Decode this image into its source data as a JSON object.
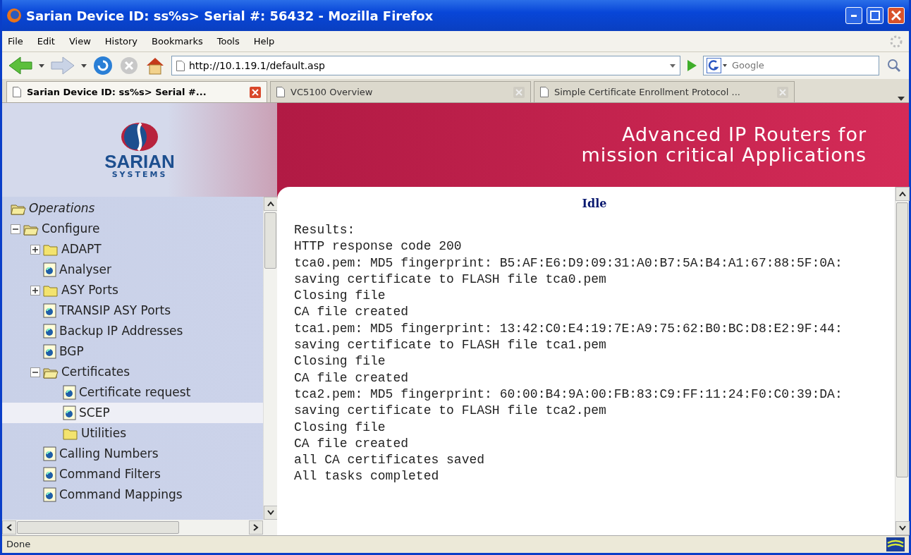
{
  "window": {
    "title": "Sarian Device ID: ss%s> Serial #: 56432 - Mozilla Firefox"
  },
  "menu": [
    "File",
    "Edit",
    "View",
    "History",
    "Bookmarks",
    "Tools",
    "Help"
  ],
  "address": {
    "value": "http://10.1.19.1/default.asp"
  },
  "search": {
    "placeholder": "Google"
  },
  "tabs": [
    {
      "label": "Sarian Device ID: ss%s> Serial #...",
      "selected": true
    },
    {
      "label": "VC5100 Overview",
      "selected": false
    },
    {
      "label": "Simple Certificate Enrollment Protocol ...",
      "selected": false
    }
  ],
  "logo": {
    "name": "SARIAN",
    "subtitle": "SYSTEMS"
  },
  "banner": {
    "lines": [
      "Advanced IP Routers for",
      "mission critical Applications"
    ]
  },
  "tree": {
    "root": "Operations",
    "items": [
      {
        "label": "Configure",
        "kind": "folder",
        "expanded": true,
        "selected": false,
        "children": [
          {
            "label": "ADAPT",
            "kind": "folder",
            "expanded": false,
            "selected": false
          },
          {
            "label": "Analyser",
            "kind": "page",
            "selected": false
          },
          {
            "label": "ASY Ports",
            "kind": "folder",
            "expanded": false,
            "selected": false
          },
          {
            "label": "TRANSIP ASY Ports",
            "kind": "page",
            "selected": false
          },
          {
            "label": "Backup IP Addresses",
            "kind": "page",
            "selected": false
          },
          {
            "label": "BGP",
            "kind": "page",
            "selected": false
          },
          {
            "label": "Certificates",
            "kind": "folder",
            "expanded": true,
            "selected": false,
            "children": [
              {
                "label": "Certificate request",
                "kind": "page",
                "selected": false
              },
              {
                "label": "SCEP",
                "kind": "page",
                "selected": true
              },
              {
                "label": "Utilities",
                "kind": "folder",
                "selected": false
              }
            ]
          },
          {
            "label": "Calling Numbers",
            "kind": "page",
            "selected": false
          },
          {
            "label": "Command Filters",
            "kind": "page",
            "selected": false
          },
          {
            "label": "Command Mappings",
            "kind": "page",
            "selected": false
          }
        ]
      }
    ]
  },
  "main": {
    "heading": "Idle",
    "lines": [
      "Results:",
      "HTTP response code 200",
      "tca0.pem: MD5 fingerprint: B5:AF:E6:D9:09:31:A0:B7:5A:B4:A1:67:88:5F:0A:",
      "saving certificate to FLASH file tca0.pem",
      "Closing file",
      "CA file created",
      "tca1.pem: MD5 fingerprint: 13:42:C0:E4:19:7E:A9:75:62:B0:BC:D8:E2:9F:44:",
      "saving certificate to FLASH file tca1.pem",
      "Closing file",
      "CA file created",
      "tca2.pem: MD5 fingerprint: 60:00:B4:9A:00:FB:83:C9:FF:11:24:F0:C0:39:DA:",
      "saving certificate to FLASH file tca2.pem",
      "Closing file",
      "CA file created",
      "all CA certificates saved",
      "All tasks completed"
    ]
  },
  "status_bar": {
    "text": "Done"
  }
}
